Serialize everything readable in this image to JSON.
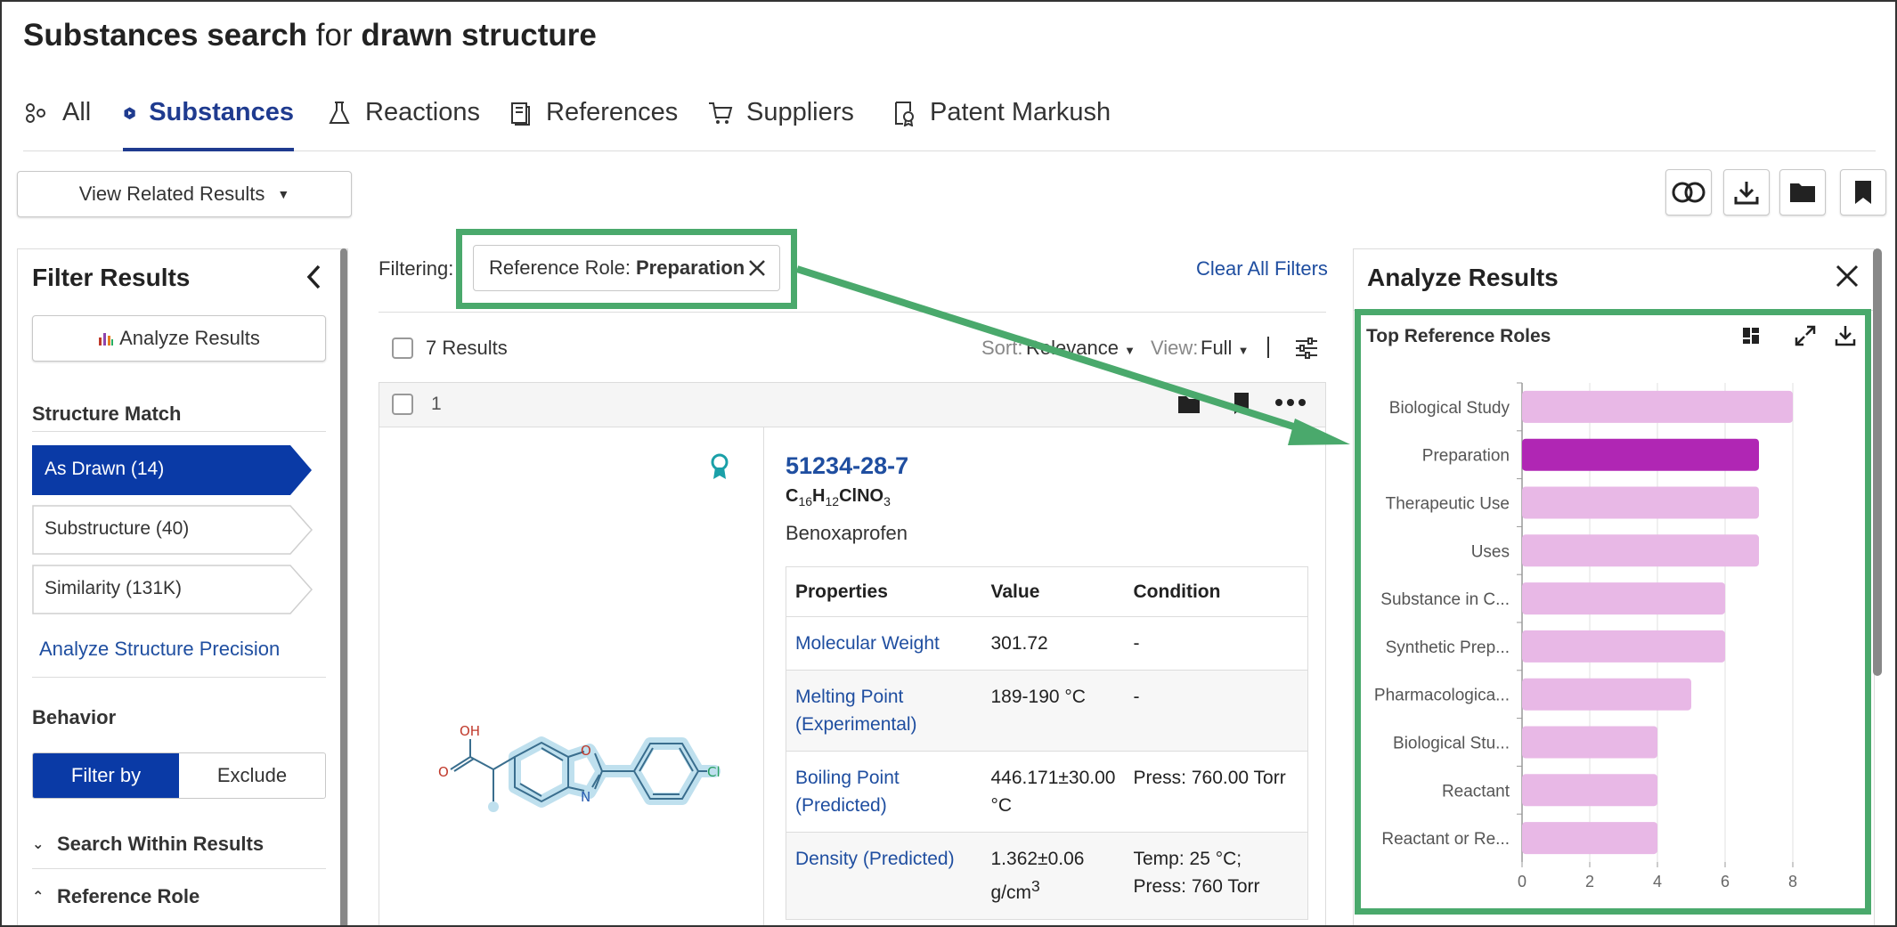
{
  "header": {
    "title_prefix": "Substances search",
    "title_mid": " for ",
    "title_suffix": "drawn structure"
  },
  "tabs": [
    {
      "label": "All",
      "icon": "all-icon",
      "active": false
    },
    {
      "label": "Substances",
      "icon": "substance-icon",
      "active": true
    },
    {
      "label": "Reactions",
      "icon": "flask-icon",
      "active": false
    },
    {
      "label": "References",
      "icon": "document-icon",
      "active": false
    },
    {
      "label": "Suppliers",
      "icon": "cart-icon",
      "active": false
    },
    {
      "label": "Patent Markush",
      "icon": "patent-icon",
      "active": false
    }
  ],
  "toolbar": {
    "related_label": "View Related Results",
    "icons": [
      "combine-icon",
      "download-icon",
      "folder-icon",
      "bookmark-icon"
    ]
  },
  "filter_panel": {
    "title": "Filter Results",
    "analyze_label": "Analyze Results",
    "structure_match_label": "Structure Match",
    "match_items": [
      {
        "label": "As Drawn (14)",
        "active": true
      },
      {
        "label": "Substructure (40)",
        "active": false
      },
      {
        "label": "Similarity (131K)",
        "active": false
      }
    ],
    "precision_link": "Analyze Structure Precision",
    "behavior_label": "Behavior",
    "filter_by": "Filter by",
    "exclude": "Exclude",
    "search_within": "Search Within Results",
    "reference_role": "Reference Role"
  },
  "results": {
    "filtering_label": "Filtering:",
    "chip_key": "Reference Role:",
    "chip_value": "Preparation",
    "clear_all": "Clear All Filters",
    "count_label": "7 Results",
    "sort_label": "Sort:",
    "sort_value": "Relevance",
    "view_label": "View:",
    "view_value": "Full",
    "card": {
      "index": "1",
      "cas": "51234-28-7",
      "formula": {
        "c": "C",
        "c_n": "16",
        "h": "H",
        "h_n": "12",
        "rest": "ClNO",
        "o_n": "3"
      },
      "name": "Benoxaprofen",
      "atom_labels": {
        "oh": "OH",
        "o_acid": "O",
        "o_ring": "O",
        "n_ring": "N",
        "cl": "Cl"
      },
      "table_headers": [
        "Properties",
        "Value",
        "Condition"
      ],
      "rows": [
        {
          "prop": "Molecular Weight",
          "value": "301.72",
          "cond": "-"
        },
        {
          "prop": "Melting Point (Experimental)",
          "value": "189-190 °C",
          "cond": "-"
        },
        {
          "prop": "Boiling Point (Predicted)",
          "value": "446.171±30.00 °C",
          "cond": "Press: 760.00 Torr"
        },
        {
          "prop": "Density (Predicted)",
          "value": "1.362±0.06 g/cm",
          "value_sup": "3",
          "cond": "Temp: 25 °C; Press: 760 Torr"
        }
      ]
    }
  },
  "analyze_panel": {
    "title": "Analyze Results",
    "chart_title": "Top Reference Roles"
  },
  "colors": {
    "accent": "#0a3aa6",
    "link": "#1f4ea0",
    "highlight_green": "#4aa96c",
    "bar_light": "#e8b8e6",
    "bar_selected": "#b026b4"
  },
  "chart_data": {
    "type": "bar",
    "orientation": "horizontal",
    "title": "Top Reference Roles",
    "categories": [
      "Biological Study",
      "Preparation",
      "Therapeutic Use",
      "Uses",
      "Substance in C...",
      "Synthetic Prep...",
      "Pharmacologica...",
      "Biological Stu...",
      "Reactant",
      "Reactant or Re..."
    ],
    "values": [
      8,
      7,
      7,
      7,
      6,
      6,
      5,
      4,
      4,
      4
    ],
    "selected": "Preparation",
    "xlim": [
      0,
      10
    ],
    "xticks": [
      0,
      2,
      4,
      6,
      8
    ],
    "grid": true
  }
}
